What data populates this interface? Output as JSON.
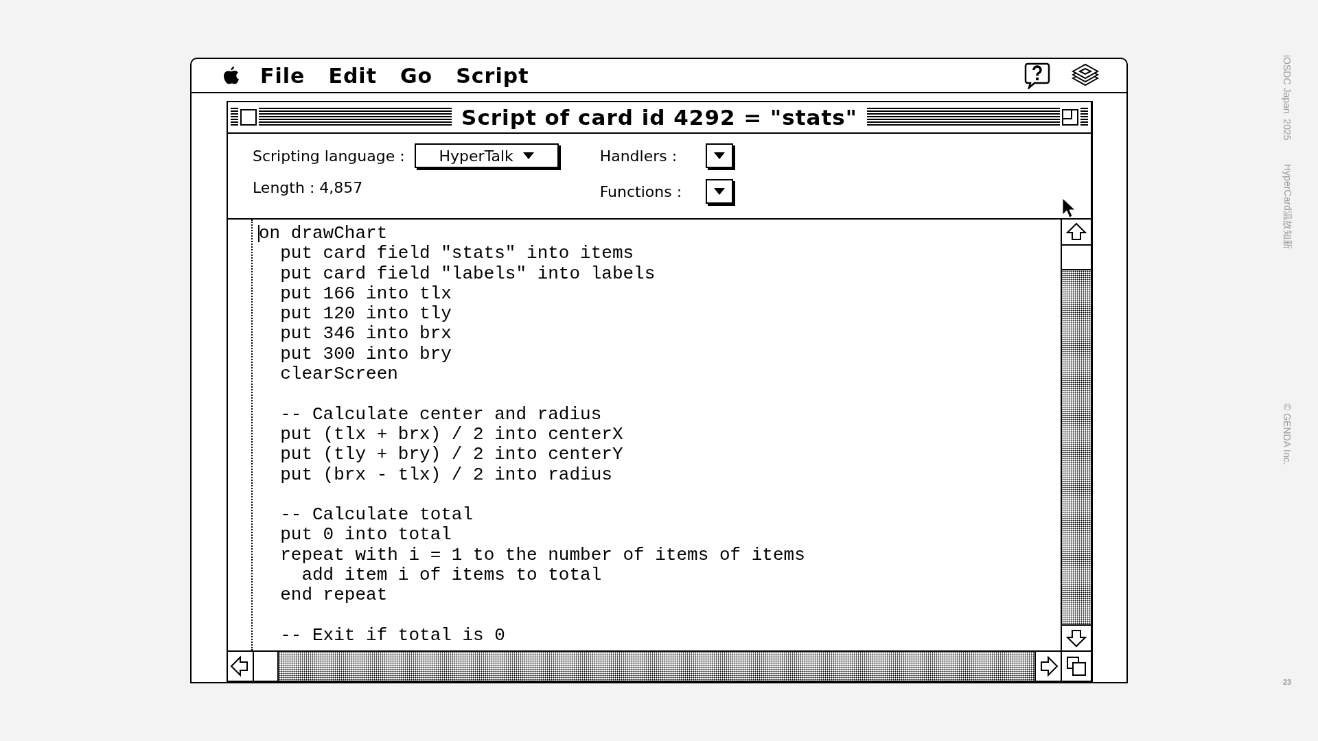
{
  "menu_bar": {
    "items": [
      "File",
      "Edit",
      "Go",
      "Script"
    ]
  },
  "window": {
    "title": "Script of card id 4292 = \"stats\""
  },
  "header": {
    "language_label": "Scripting language :",
    "language_value": "HyperTalk",
    "handlers_label": "Handlers :",
    "length_label": "Length : 4,857",
    "functions_label": "Functions :"
  },
  "script": {
    "lines": [
      {
        "text": "on drawChart",
        "blank_before": false
      },
      {
        "text": "  put card field \"stats\" into items",
        "blank_before": false
      },
      {
        "text": "  put card field \"labels\" into labels",
        "blank_before": false
      },
      {
        "text": "  put 166 into tlx",
        "blank_before": false
      },
      {
        "text": "  put 120 into tly",
        "blank_before": false
      },
      {
        "text": "  put 346 into brx",
        "blank_before": false
      },
      {
        "text": "  put 300 into bry",
        "blank_before": false
      },
      {
        "text": "  clearScreen",
        "blank_before": false
      },
      {
        "text": "  -- Calculate center and radius",
        "blank_before": true
      },
      {
        "text": "  put (tlx + brx) / 2 into centerX",
        "blank_before": false
      },
      {
        "text": "  put (tly + bry) / 2 into centerY",
        "blank_before": false
      },
      {
        "text": "  put (brx - tlx) / 2 into radius",
        "blank_before": false
      },
      {
        "text": "  -- Calculate total",
        "blank_before": true
      },
      {
        "text": "  put 0 into total",
        "blank_before": false
      },
      {
        "text": "  repeat with i = 1 to the number of items of items",
        "blank_before": false
      },
      {
        "text": "    add item i of items to total",
        "blank_before": false
      },
      {
        "text": "  end repeat",
        "blank_before": false
      },
      {
        "text": "  -- Exit if total is 0",
        "blank_before": true
      }
    ]
  },
  "slide": {
    "event": "iOSDC Japan  2025",
    "title": "HyperCard温故知新",
    "copyright": "© GENDA Inc.",
    "page": "23"
  }
}
